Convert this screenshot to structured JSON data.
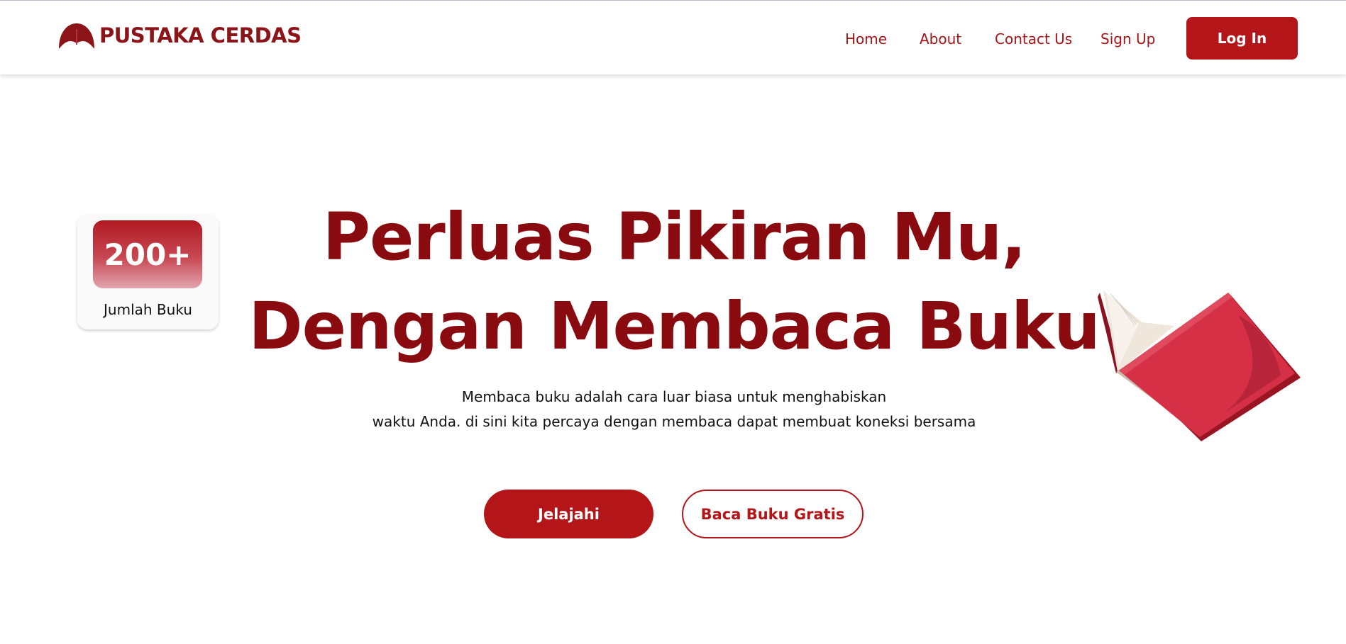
{
  "brand": {
    "name": "PUSTAKA CERDAS",
    "logo_icon": "book-arch-logo-icon",
    "color": "#8b1418"
  },
  "nav": {
    "home": "Home",
    "about": "About",
    "contact": "Contact Us",
    "signup": "Sign Up",
    "login": "Log In"
  },
  "stat": {
    "value": "200+",
    "label": "Jumlah Buku"
  },
  "hero": {
    "title_line1": "Perluas Pikiran Mu,",
    "title_line2": "Dengan Membaca Buku",
    "desc_line1": "Membaca buku adalah cara luar biasa untuk menghabiskan",
    "desc_line2": "waktu Anda. di sini kita percaya dengan membaca dapat membuat koneksi bersama",
    "primary_button": "Jelajahi",
    "secondary_button": "Baca Buku Gratis",
    "illustration_icon": "open-book-icon"
  },
  "colors": {
    "accent": "#b31519",
    "title": "#8a0b0f",
    "book_cover": "#d53046"
  }
}
